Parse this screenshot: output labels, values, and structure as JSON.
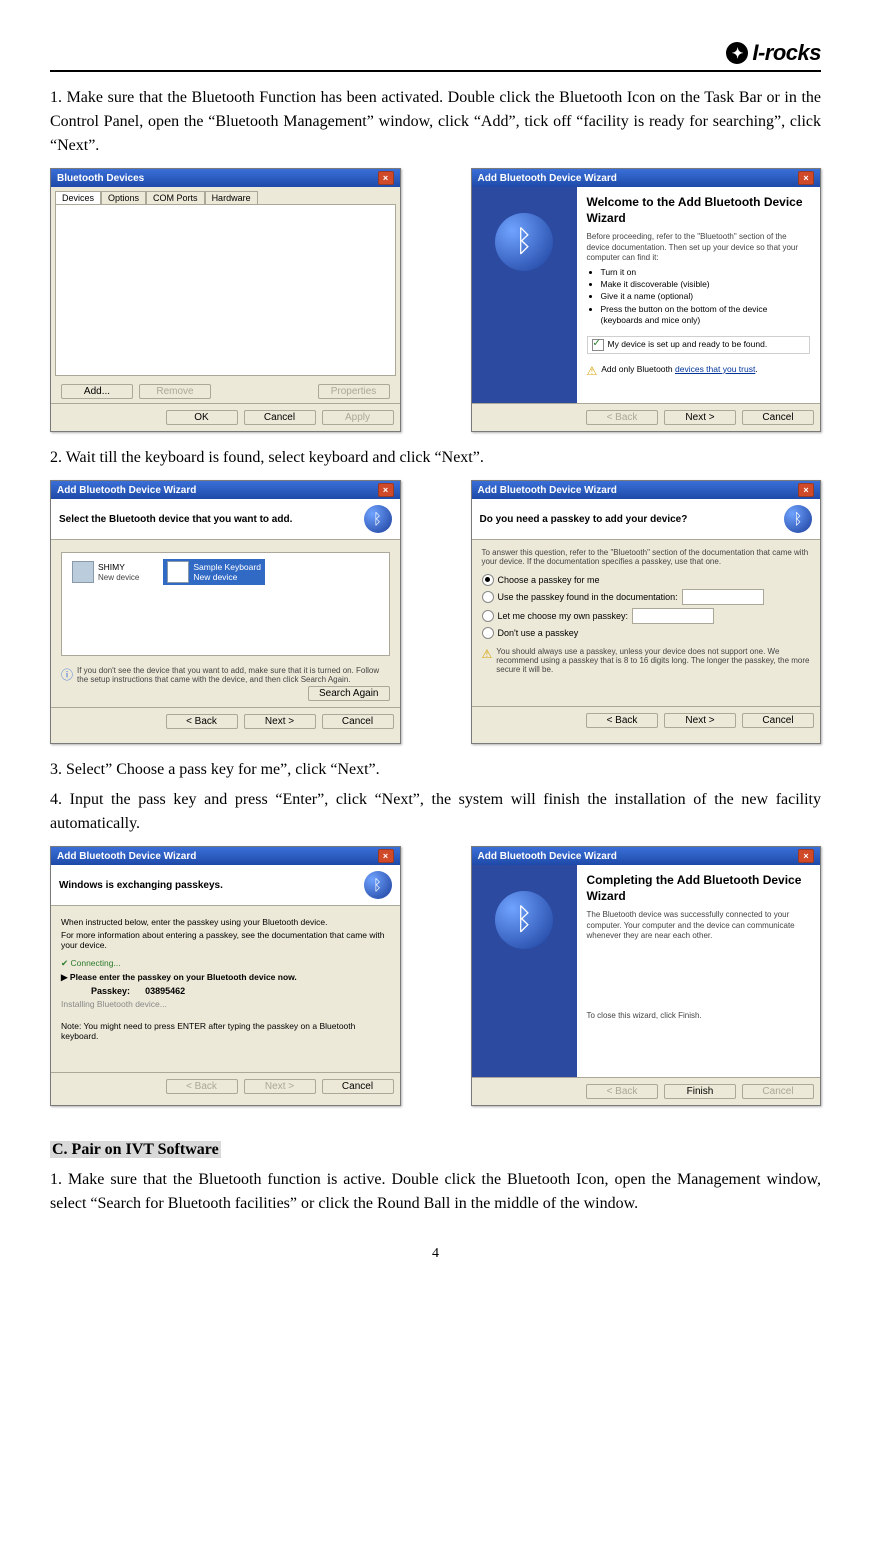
{
  "logo_text": "I-rocks",
  "step1_text": "1. Make sure that the Bluetooth Function has been activated. Double click the Bluetooth Icon on the Task Bar or in the Control Panel, open the “Bluetooth Management” window, click “Add”, tick off “facility is ready for searching”, click “Next”.",
  "bt_devices": {
    "title": "Bluetooth Devices",
    "tabs": [
      "Devices",
      "Options",
      "COM Ports",
      "Hardware"
    ],
    "add": "Add...",
    "remove": "Remove",
    "properties": "Properties",
    "ok": "OK",
    "cancel": "Cancel",
    "apply": "Apply"
  },
  "wiz_welcome": {
    "title": "Add Bluetooth Device Wizard",
    "heading": "Welcome to the Add Bluetooth Device Wizard",
    "intro": "Before proceeding, refer to the \"Bluetooth\" section of the device documentation. Then set up your device so that your computer can find it:",
    "bullets": [
      "Turn it on",
      "Make it discoverable (visible)",
      "Give it a name (optional)",
      "Press the button on the bottom of the device (keyboards and mice only)"
    ],
    "checkbox": "My device is set up and ready to be found.",
    "hint_prefix": "Add only Bluetooth ",
    "hint_link": "devices that you trust",
    "back": "< Back",
    "next": "Next >",
    "cancel": "Cancel"
  },
  "step2_text": "2. Wait till the keyboard is found, select keyboard and click “Next”.",
  "wiz_select": {
    "title": "Add Bluetooth Device Wizard",
    "banner": "Select the Bluetooth device that you want to add.",
    "device1_name": "SHIMY",
    "device1_sub": "New device",
    "device2_name": "Sample Keyboard",
    "device2_sub": "New device",
    "tip": "If you don't see the device that you want to add, make sure that it is turned on. Follow the setup instructions that came with the device, and then click Search Again.",
    "search_again": "Search Again",
    "back": "< Back",
    "next": "Next >",
    "cancel": "Cancel"
  },
  "wiz_passkey": {
    "title": "Add Bluetooth Device Wizard",
    "banner": "Do you need a passkey to add your device?",
    "intro": "To answer this question, refer to the \"Bluetooth\" section of the documentation that came with your device. If the documentation specifies a passkey, use that one.",
    "opt1": "Choose a passkey for me",
    "opt2": "Use the passkey found in the documentation:",
    "opt3": "Let me choose my own passkey:",
    "opt4": "Don't use a passkey",
    "note": "You should always use a passkey, unless your device does not support one. We recommend using a passkey that is 8 to 16 digits long. The longer the passkey, the more secure it will be.",
    "back": "< Back",
    "next": "Next >",
    "cancel": "Cancel"
  },
  "step3_text": "3. Select” Choose a pass key for me”, click “Next”.",
  "step4_text": "4. Input the pass key and press “Enter”, click “Next”, the system will finish the installation of the new facility automatically.",
  "wiz_exchange": {
    "title": "Add Bluetooth Device Wizard",
    "banner": "Windows is exchanging passkeys.",
    "line1": "When instructed below, enter the passkey using your Bluetooth device.",
    "line2": "For more information about entering a passkey, see the documentation that came with your device.",
    "connecting": "Connecting...",
    "instruct": "Please enter the passkey on your Bluetooth device now.",
    "pass_label": "Passkey:",
    "pass_value": "03895462",
    "installing": "Installing Bluetooth device...",
    "note": "Note: You might need to press ENTER after typing the passkey on a Bluetooth keyboard.",
    "back": "< Back",
    "next": "Next >",
    "cancel": "Cancel"
  },
  "wiz_complete": {
    "title": "Add Bluetooth Device Wizard",
    "heading": "Completing the Add Bluetooth Device Wizard",
    "intro": "The Bluetooth device was successfully connected to your computer. Your computer and the device can communicate whenever they are near each other.",
    "closing": "To close this wizard, click Finish.",
    "back": "< Back",
    "finish": "Finish",
    "cancel": "Cancel"
  },
  "section_c_head": "C. Pair on IVT Software",
  "section_c_text": "1. Make sure that the Bluetooth function is active. Double click the Bluetooth Icon, open the Management window, select “Search for Bluetooth facilities” or click the Round Ball in the middle of the window.",
  "page_number": "4"
}
